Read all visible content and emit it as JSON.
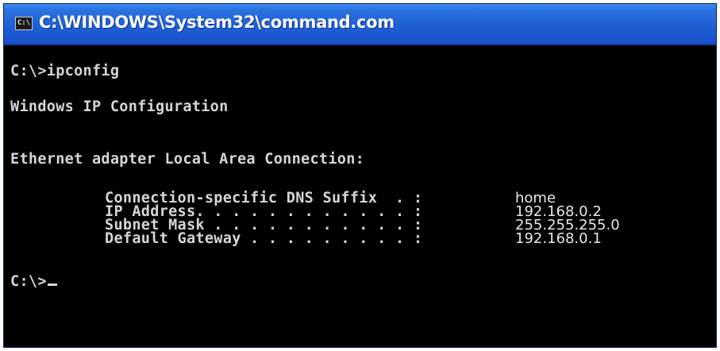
{
  "window": {
    "title": "C:\\WINDOWS\\System32\\command.com",
    "icon": "C:\\"
  },
  "console": {
    "command_line": "C:\\>ipconfig",
    "header": "Windows IP Configuration",
    "adapter": "Ethernet adapter Local Area Connection:",
    "entries": [
      {
        "label": "Connection-specific DNS Suffix  . :",
        "value": "home"
      },
      {
        "label": "IP Address. . . . . . . . . . . . :",
        "value": "192.168.0.2"
      },
      {
        "label": "Subnet Mask . . . . . . . . . . . :",
        "value": "255.255.255.0"
      },
      {
        "label": "Default Gateway . . . . . . . . . :",
        "value": "192.168.0.1"
      }
    ],
    "prompt": "C:\\>"
  }
}
